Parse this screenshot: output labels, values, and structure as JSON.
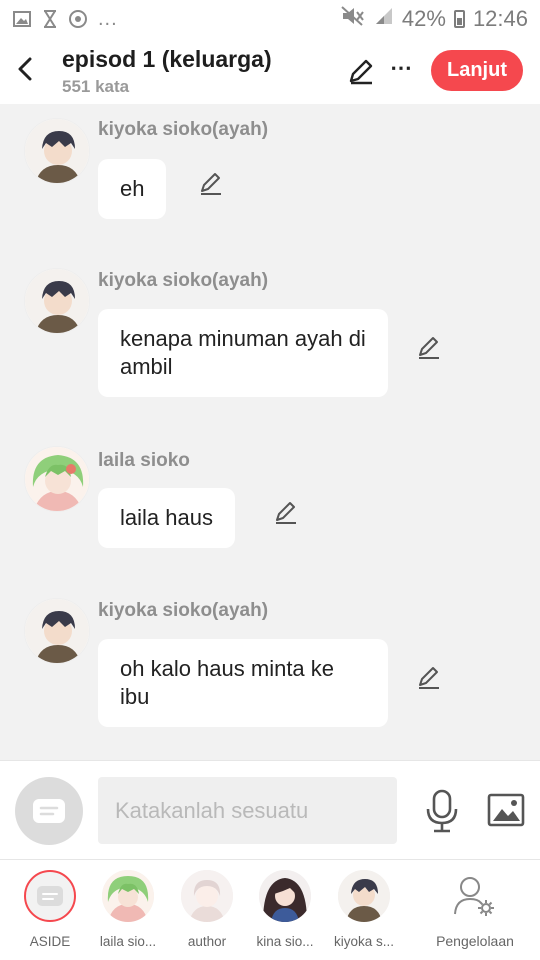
{
  "status_bar": {
    "dots": "...",
    "battery": "42%",
    "time": "12:46",
    "icons": [
      "image-icon",
      "hourglass-icon",
      "chrome-icon",
      "mute-icon",
      "signal-icon",
      "battery-icon"
    ]
  },
  "header": {
    "title": "episod 1 (keluarga)",
    "word_count": "551 kata",
    "next_label": "Lanjut",
    "more": "⋯",
    "accent": "#f5484e"
  },
  "messages": [
    {
      "sender": "kiyoka sioko(ayah)",
      "text": "eh",
      "avatar": "kiyoka"
    },
    {
      "sender": "kiyoka sioko(ayah)",
      "text": "kenapa minuman ayah di ambil",
      "avatar": "kiyoka"
    },
    {
      "sender": "laila sioko",
      "text": "laila haus",
      "avatar": "laila"
    },
    {
      "sender": "kiyoka sioko(ayah)",
      "text": "oh kalo haus minta ke ibu",
      "avatar": "kiyoka"
    }
  ],
  "input": {
    "placeholder": "Katakanlah sesuatu"
  },
  "characters": [
    {
      "label": "ASIDE"
    },
    {
      "label": "laila sio..."
    },
    {
      "label": "author"
    },
    {
      "label": "kina sio..."
    },
    {
      "label": "kiyoka s..."
    }
  ],
  "management_label": "Pengelolaan"
}
